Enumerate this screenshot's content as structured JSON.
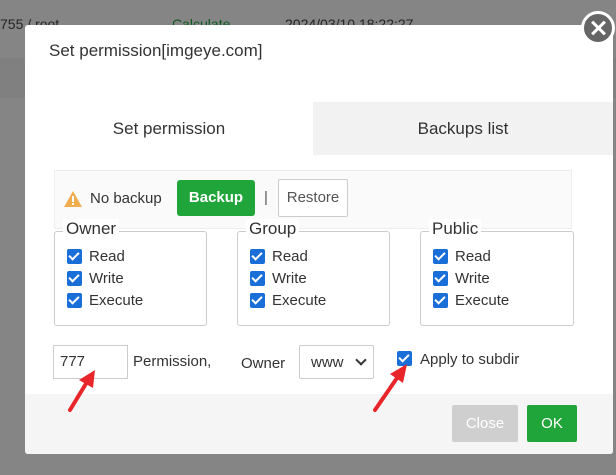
{
  "background": {
    "row1": {
      "perm": "755 / root",
      "action": "Calculate",
      "time": "2024/03/10 18:22:27"
    }
  },
  "dialog": {
    "title": "Set permission[imgeye.com]",
    "tabs": [
      {
        "label": "Set permission",
        "active": true
      },
      {
        "label": "Backups list",
        "active": false
      }
    ],
    "backup_bar": {
      "warning_icon": "warning-triangle-icon",
      "status_text": "No backup",
      "backup_label": "Backup",
      "separator": "|",
      "restore_label": "Restore"
    },
    "groups": [
      {
        "title": "Owner",
        "items": [
          {
            "label": "Read",
            "checked": true
          },
          {
            "label": "Write",
            "checked": true
          },
          {
            "label": "Execute",
            "checked": true
          }
        ]
      },
      {
        "title": "Group",
        "items": [
          {
            "label": "Read",
            "checked": true
          },
          {
            "label": "Write",
            "checked": true
          },
          {
            "label": "Execute",
            "checked": true
          }
        ]
      },
      {
        "title": "Public",
        "items": [
          {
            "label": "Read",
            "checked": true
          },
          {
            "label": "Write",
            "checked": true
          },
          {
            "label": "Execute",
            "checked": true
          }
        ]
      }
    ],
    "permission": {
      "value": "777",
      "label": "Permission,"
    },
    "owner": {
      "label": "Owner",
      "selected": "www"
    },
    "apply_subdir": {
      "label": "Apply to subdir",
      "checked": true
    },
    "footer": {
      "close_label": "Close",
      "ok_label": "OK"
    }
  },
  "colors": {
    "accent_green": "#20a53a",
    "checkbox_blue": "#1a6ed8",
    "annotation_red": "#e8262a"
  }
}
